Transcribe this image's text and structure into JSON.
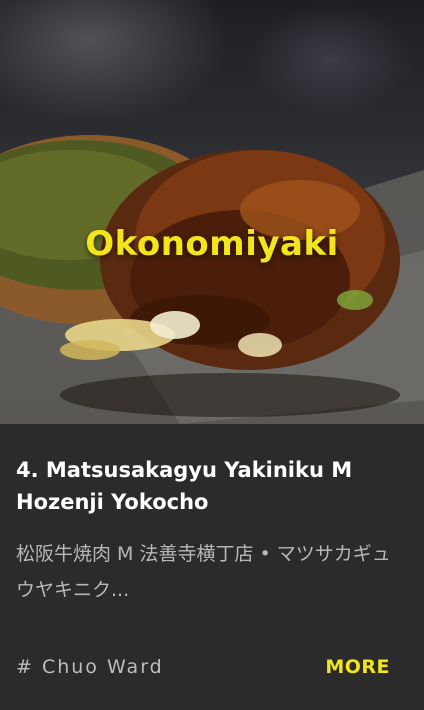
{
  "hero": {
    "category": "Okonomiyaki"
  },
  "listing": {
    "name": "4. Matsusakagyu Yakiniku M Hozenji Yokocho",
    "subtitle": "松阪牛焼肉 M 法善寺横丁店 • マツサカギュウヤキニク...",
    "location": "# Chuo Ward",
    "more_label": "MORE"
  },
  "colors": {
    "accent": "#f2e51c",
    "background": "#2b2b2b",
    "title_text": "#ffffff",
    "secondary_text": "#b7b7b7"
  }
}
